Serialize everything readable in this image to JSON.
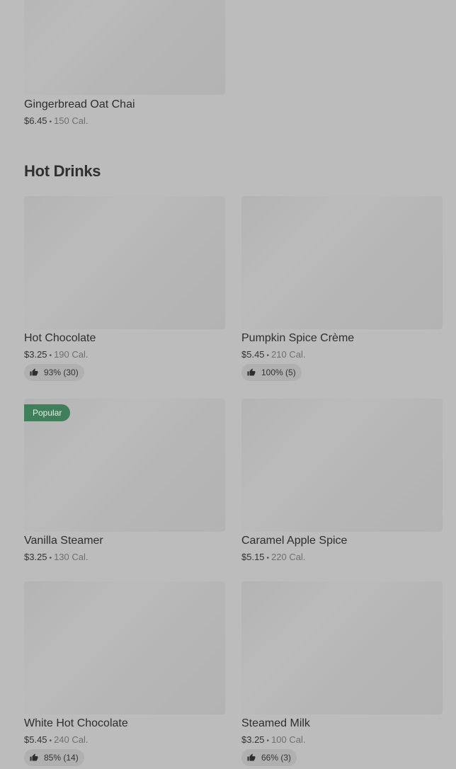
{
  "top_item": {
    "name": "Gingerbread Oat Chai",
    "price": "$6.45",
    "calories": "150 Cal."
  },
  "section": {
    "title": "Hot Drinks"
  },
  "items": [
    {
      "name": "Hot Chocolate",
      "price": "$3.25",
      "calories": "190 Cal.",
      "rating": "93% (30)"
    },
    {
      "name": "Pumpkin Spice Crème",
      "price": "$5.45",
      "calories": "210 Cal.",
      "rating": "100% (5)"
    },
    {
      "name": "Vanilla Steamer",
      "price": "$3.25",
      "calories": "130 Cal.",
      "badge": "Popular"
    },
    {
      "name": "Caramel Apple Spice",
      "price": "$5.15",
      "calories": "220 Cal."
    },
    {
      "name": "White Hot Chocolate",
      "price": "$5.45",
      "calories": "240 Cal.",
      "rating": "85% (14)"
    },
    {
      "name": "Steamed Milk",
      "price": "$3.25",
      "calories": "100 Cal.",
      "rating": "66% (3)"
    }
  ],
  "separator": "•",
  "icons": {
    "rating": "thumbs-up-icon"
  },
  "colors": {
    "background": "#bcbcbc",
    "badge": "#3f7f5a"
  }
}
